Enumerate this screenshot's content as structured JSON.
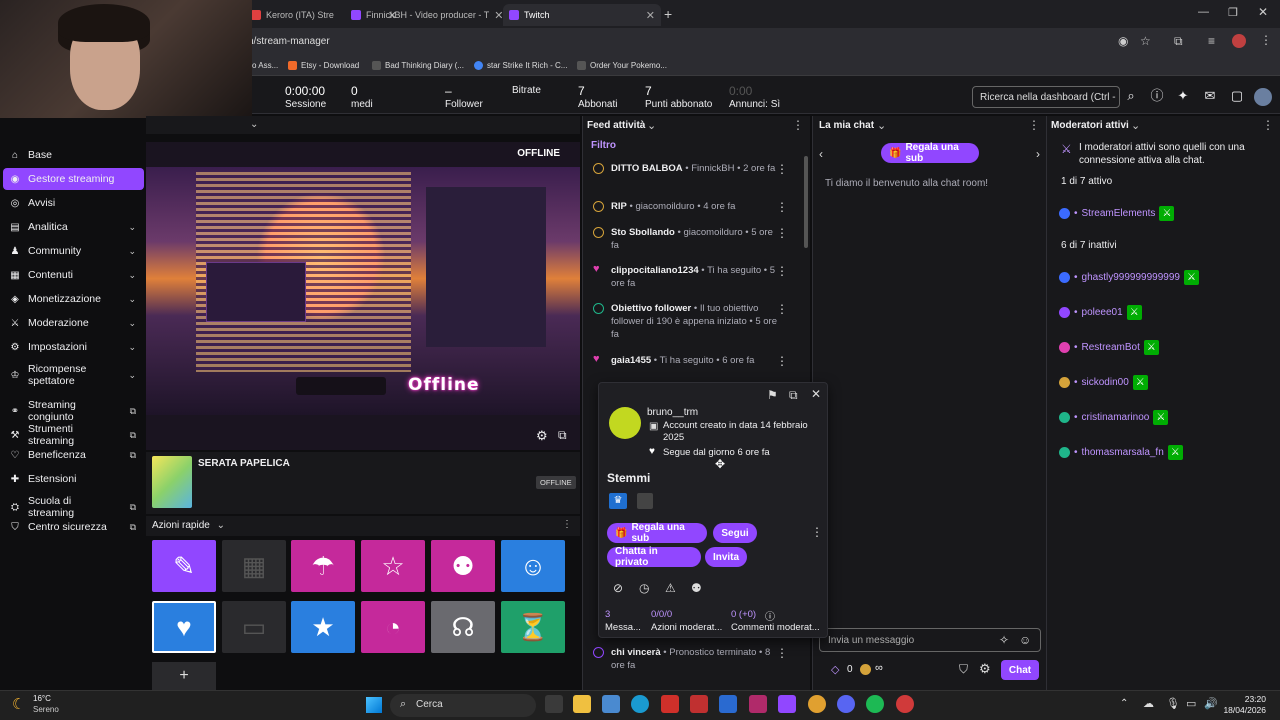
{
  "browser": {
    "tabs": [
      {
        "label": "Keroro (ITA) Stre",
        "active": false
      },
      {
        "label": "FinnickBH - Video producer - T",
        "active": false
      },
      {
        "label": "Twitch",
        "active": true
      }
    ],
    "url": "h/stream-manager",
    "bookmarks": [
      "o Ass...",
      "Etsy - Download",
      "Bad Thinking Diary (...",
      "star Strike It Rich - C...",
      "Order Your Pokemo..."
    ]
  },
  "stats": [
    {
      "value": "0:00:00",
      "label": "Sessione"
    },
    {
      "value": "0",
      "label": "medi"
    },
    {
      "value": "–",
      "label": "Follower"
    },
    {
      "value": "",
      "label": "Bitrate"
    },
    {
      "value": "7",
      "label": "Abbonati"
    },
    {
      "value": "7",
      "label": "Punti abbonato"
    },
    {
      "value": "0:00",
      "label": "Annunci: Sì"
    }
  ],
  "search": {
    "placeholder": "Ricerca nella dashboard (Ctrl -"
  },
  "sidebar": {
    "items": [
      {
        "label": "Base",
        "icon": "home-icon"
      },
      {
        "label": "Gestore streaming",
        "icon": "broadcast-icon",
        "active": true
      },
      {
        "label": "Avvisi",
        "icon": "alert-icon"
      },
      {
        "label": "Analitica",
        "icon": "chart-icon",
        "chevron": true
      },
      {
        "label": "Community",
        "icon": "people-icon",
        "chevron": true
      },
      {
        "label": "Contenuti",
        "icon": "content-icon",
        "chevron": true
      },
      {
        "label": "Monetizzazione",
        "icon": "money-icon",
        "chevron": true
      },
      {
        "label": "Moderazione",
        "icon": "sword-icon",
        "chevron": true
      },
      {
        "label": "Impostazioni",
        "icon": "gear-icon",
        "chevron": true
      },
      {
        "label": "Ricompense spettatore",
        "icon": "reward-icon",
        "chevron": true
      },
      {
        "label": "Streaming congiunto",
        "icon": "collab-icon",
        "external": true
      },
      {
        "label": "Strumenti streaming",
        "icon": "tools-icon",
        "external": true
      },
      {
        "label": "Beneficenza",
        "icon": "heart-icon",
        "external": true
      },
      {
        "label": "Estensioni",
        "icon": "puzzle-icon",
        "external": false
      },
      {
        "label": "Scuola di streaming",
        "icon": "school-icon",
        "external": true
      },
      {
        "label": "Centro sicurezza",
        "icon": "shield-icon",
        "external": true
      }
    ]
  },
  "preview": {
    "status": "OFFLINE",
    "overlay_text": "Offline"
  },
  "stream_info": {
    "title": "SERATA PAPELICA",
    "badge": "OFFLINE"
  },
  "quick_actions": {
    "title": "Azioni rapide"
  },
  "feed": {
    "title": "Feed attività",
    "filter": "Filtro",
    "items": [
      {
        "bold": "DITTO BALBOA",
        "text": " • FinnickBH • 2 ore fa",
        "type": "cheer"
      },
      {
        "bold": "RIP",
        "text": " • giacomoilduro • 4 ore fa",
        "type": "cheer"
      },
      {
        "bold": "Sto Sbollando",
        "text": " • giacomoilduro • 5 ore fa",
        "type": "cheer"
      },
      {
        "bold": "clippocitaliano1234",
        "text": " • Ti ha seguito • 5 ore fa",
        "type": "follow"
      },
      {
        "bold": "Obiettivo follower",
        "text": " • Il tuo obiettivo follower di 190 è appena iniziato • 5 ore fa",
        "type": "goal"
      },
      {
        "bold": "gaia1455",
        "text": " • Ti ha seguito • 6 ore fa",
        "type": "follow"
      },
      {
        "bold": "chi vincerà",
        "text": " • Pronostico terminato • 8 ore fa",
        "type": "prediction"
      }
    ]
  },
  "user_card": {
    "username": "bruno__trm",
    "created": "Account creato in data 14 febbraio 2025",
    "follow": "Segue dal giorno 6 ore fa",
    "badges_title": "Stemmi",
    "btn_gift": "Regala una sub",
    "btn_follow": "Segui",
    "btn_whisper": "Chatta in privato",
    "btn_invite": "Invita",
    "stats": [
      {
        "value": "3",
        "label": "Messa..."
      },
      {
        "value": "0/0/0",
        "label": "Azioni moderat..."
      },
      {
        "value": "0 (+0)",
        "label": "Commenti moderat..."
      }
    ]
  },
  "chat": {
    "title": "La mia chat",
    "gift_label": "Regala una sub",
    "welcome": "Ti diamo il benvenuto alla chat room!",
    "input_placeholder": "Invia un messaggio",
    "points": "0",
    "points2": "∞",
    "send": "Chat"
  },
  "mods": {
    "title": "Moderatori attivi",
    "info": "I moderatori attivi sono quelli con una connessione attiva alla chat.",
    "active_count": "1 di 7 attivo",
    "inactive_count": "6 di 7 inattivi",
    "active": [
      {
        "name": "StreamElements",
        "color": "#3b6bff"
      }
    ],
    "inactive": [
      {
        "name": "ghastly999999999999",
        "color": "#3b6bff"
      },
      {
        "name": "poleee01",
        "color": "#9147ff"
      },
      {
        "name": "RestreamBot",
        "color": "#e040b0"
      },
      {
        "name": "sickodin00",
        "color": "#d4a23a"
      },
      {
        "name": "cristinamarinoo",
        "color": "#1fb58a"
      },
      {
        "name": "thomasmarsala_fn",
        "color": "#1fb58a"
      }
    ]
  },
  "taskbar": {
    "weather_temp": "16°C",
    "weather_text": "Sereno",
    "search": "Cerca",
    "time": "23:20",
    "date": "18/04/2026"
  }
}
